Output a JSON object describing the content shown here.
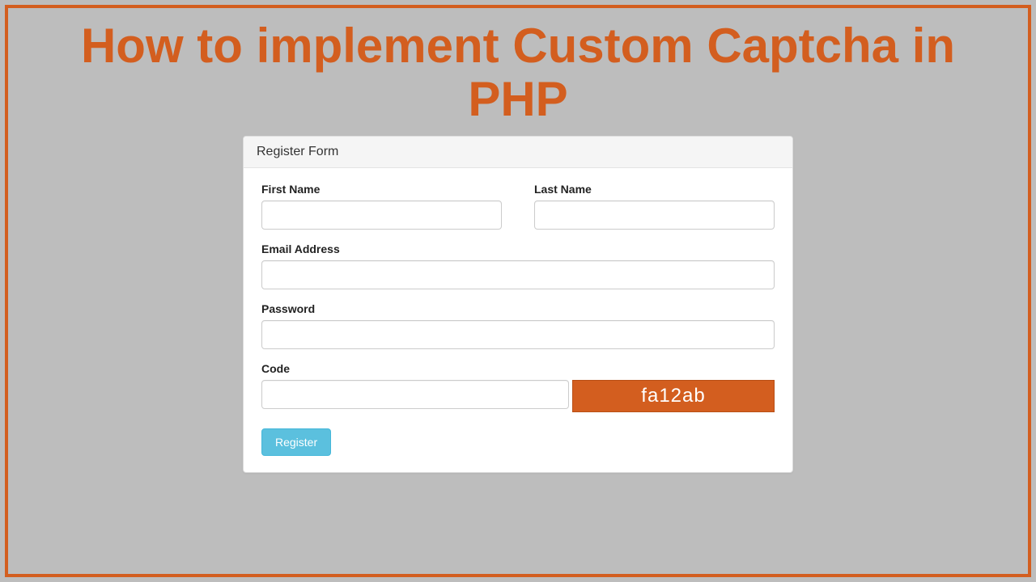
{
  "page": {
    "title": "How to implement Custom Captcha in PHP"
  },
  "panel": {
    "header": "Register Form"
  },
  "form": {
    "first_name": {
      "label": "First Name",
      "value": ""
    },
    "last_name": {
      "label": "Last Name",
      "value": ""
    },
    "email": {
      "label": "Email Address",
      "value": ""
    },
    "password": {
      "label": "Password",
      "value": ""
    },
    "code": {
      "label": "Code",
      "value": ""
    },
    "captcha_text": "fa12ab",
    "submit_label": "Register"
  },
  "colors": {
    "accent": "#d35e1f",
    "button": "#5bc0de",
    "background": "#bdbdbd"
  }
}
